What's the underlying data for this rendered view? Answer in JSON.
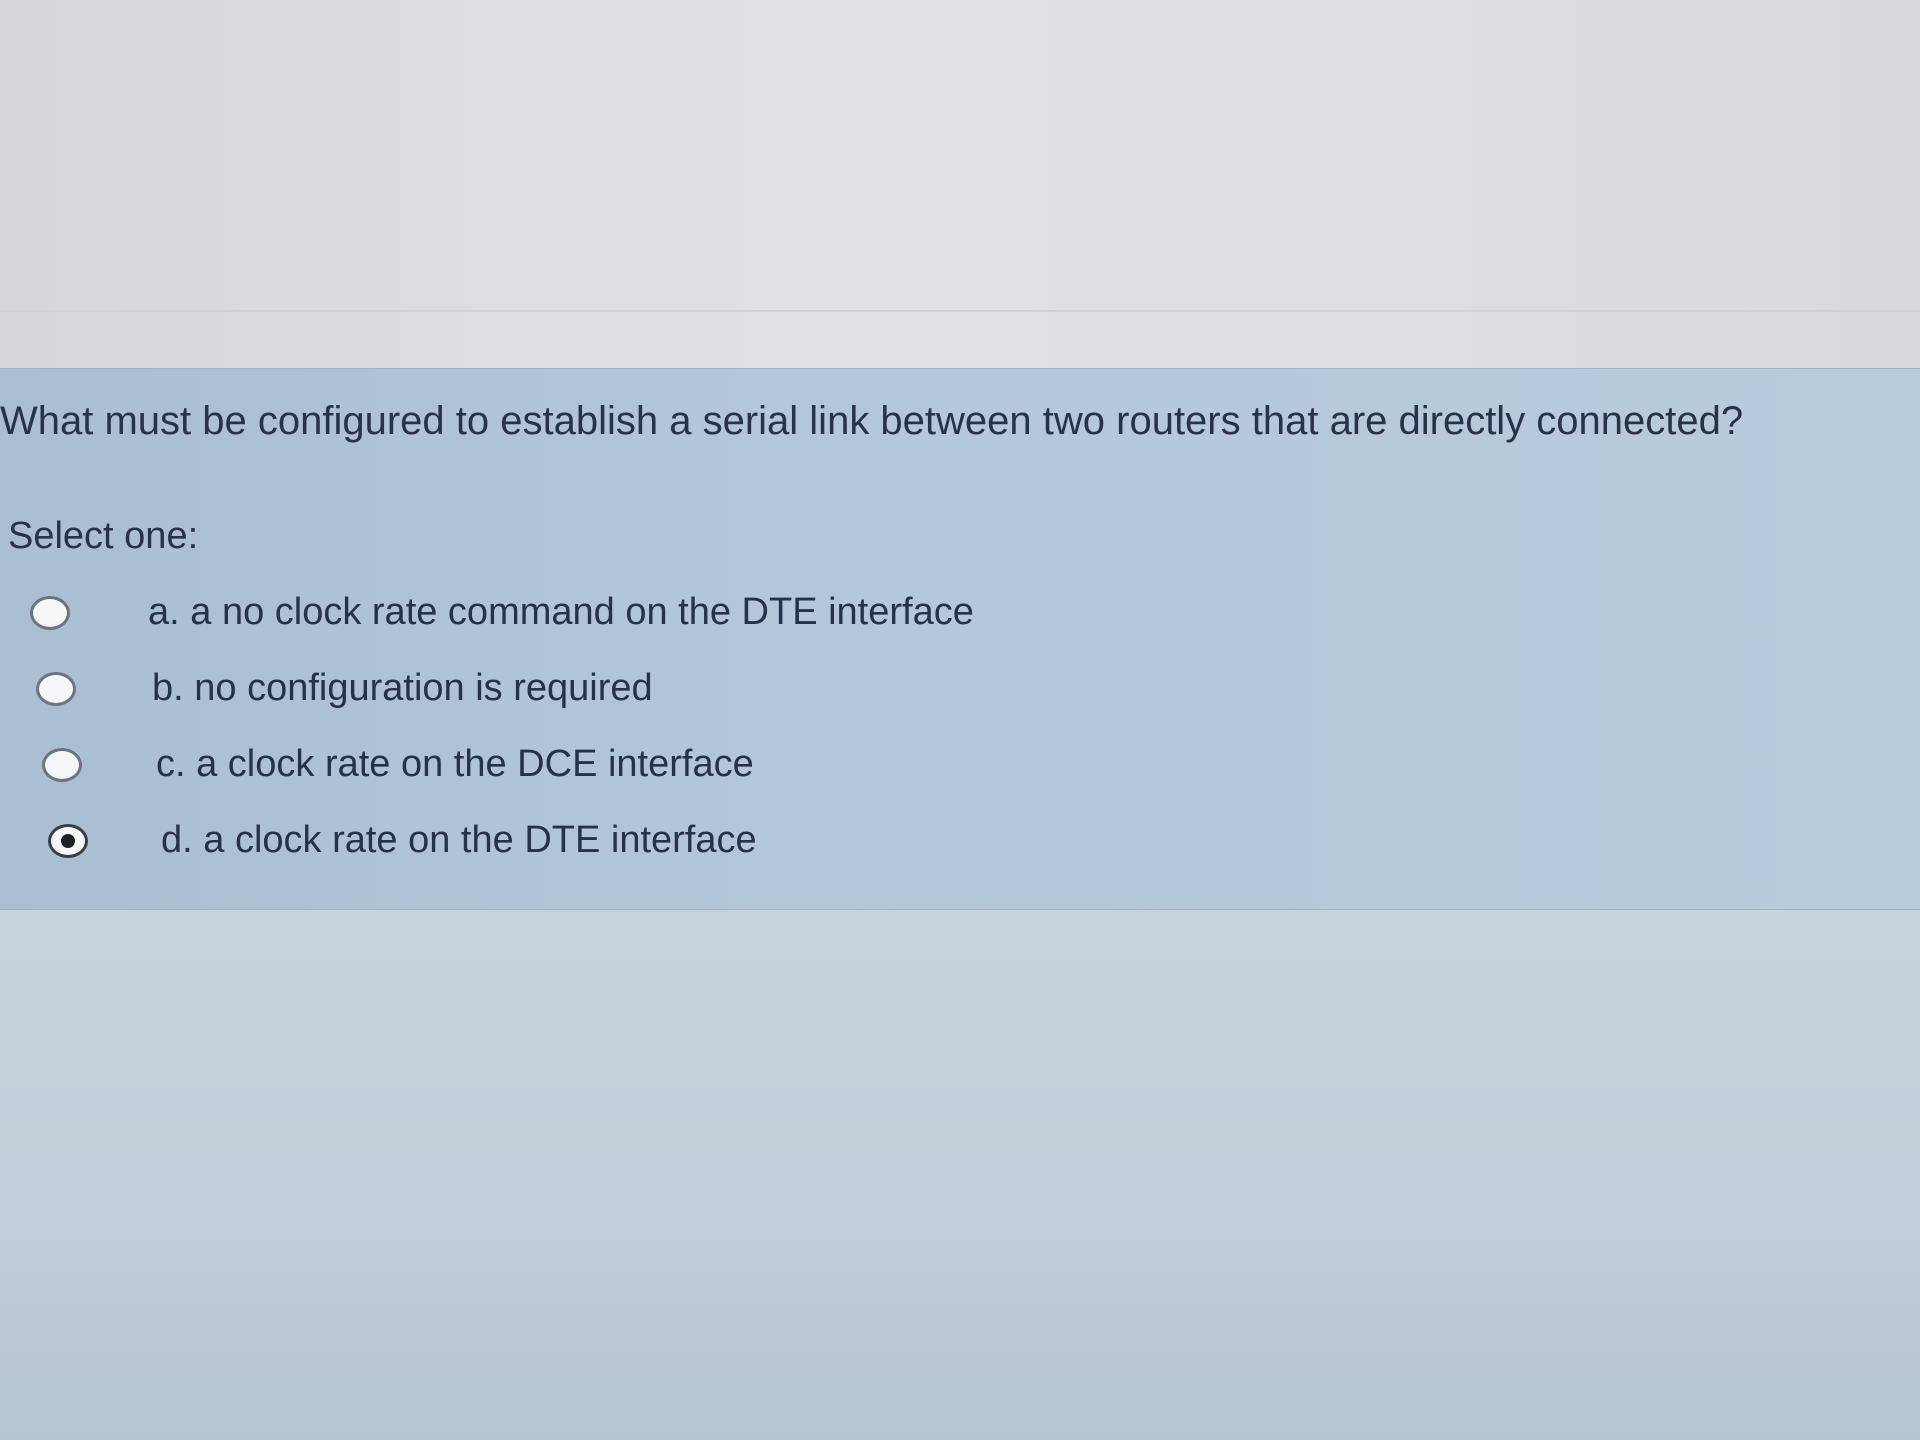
{
  "question": {
    "text": "What must be configured to establish a serial link between two routers that are directly connected?",
    "select_label": "Select one:"
  },
  "options": [
    {
      "label": "a. a no clock rate command on the DTE interface",
      "selected": false
    },
    {
      "label": "b. no configuration is required",
      "selected": false
    },
    {
      "label": "c. a clock rate on the DCE interface",
      "selected": false
    },
    {
      "label": "d. a clock rate on the DTE interface",
      "selected": true
    }
  ]
}
